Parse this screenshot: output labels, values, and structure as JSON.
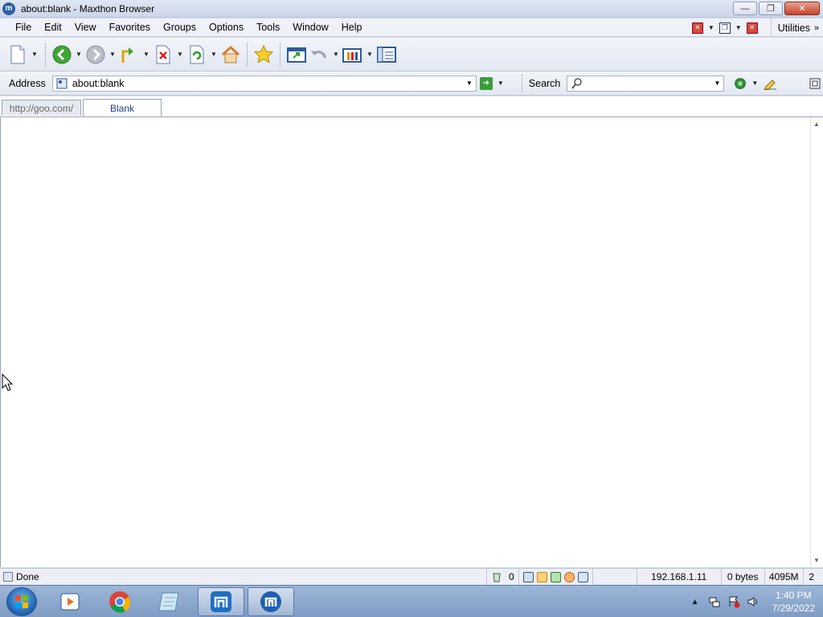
{
  "window": {
    "title": "about:blank - Maxthon Browser",
    "controls": {
      "minimize": "—",
      "maximize": "❐",
      "close": "✕"
    }
  },
  "menu": {
    "items": [
      "File",
      "Edit",
      "View",
      "Favorites",
      "Groups",
      "Options",
      "Tools",
      "Window",
      "Help"
    ],
    "utilities": "Utilities",
    "overflow": "»"
  },
  "toolbar": {
    "buttons": [
      "new-page",
      "back",
      "forward",
      "up",
      "stop",
      "refresh",
      "home",
      "favorites",
      "open-page",
      "undo",
      "groups",
      "sidebar"
    ]
  },
  "address": {
    "label": "Address",
    "url": "about:blank",
    "search_label": "Search",
    "search_value": ""
  },
  "tabs": [
    {
      "label": "http://goo.com/",
      "active": false
    },
    {
      "label": "Blank",
      "active": true
    }
  ],
  "status": {
    "text": "Done",
    "count": "0",
    "ip": "192.168.1.11",
    "bytes": "0 bytes",
    "memory": "4095M",
    "extra": "2"
  },
  "taskbar": {
    "apps": [
      "media-player",
      "chrome",
      "notepad",
      "maxthon",
      "maxthon-active"
    ],
    "time": "1:40 PM",
    "date": "7/29/2022"
  },
  "colors": {
    "accent": "#1c3d8a",
    "taskbar": "#8fa9cf",
    "close_red": "#c4432b"
  }
}
